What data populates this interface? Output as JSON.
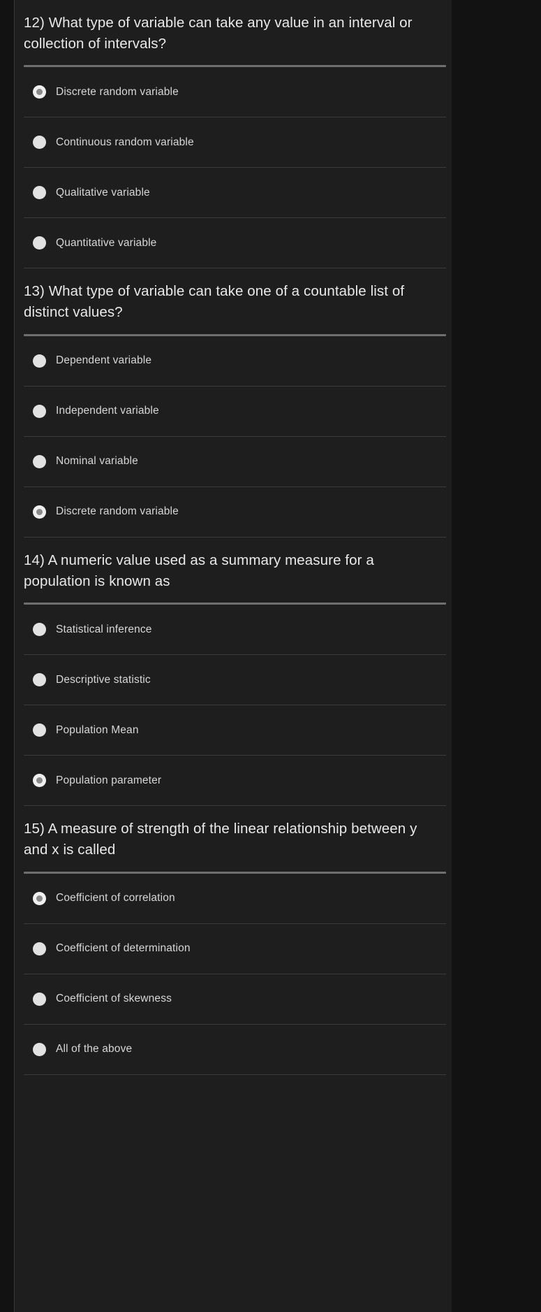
{
  "theme": {
    "page_background": "#121212",
    "panel_background": "#1e1e1e",
    "question_text_color": "#e9e9e9",
    "option_text_color": "#d7d7d7",
    "strong_divider_color": "#6f6f6f",
    "thin_divider_color": "#3b3b3b",
    "radio_fill_color": "#e2e2e2",
    "radio_selected_dot_color": "#8a8a8a"
  },
  "quiz": {
    "questions": [
      {
        "number": "12)",
        "text": "12) What type of variable can take any value in an interval or collection of intervals?",
        "options": [
          {
            "label": "Discrete random variable",
            "selected": true
          },
          {
            "label": "Continuous random variable",
            "selected": false
          },
          {
            "label": "Qualitative variable",
            "selected": false
          },
          {
            "label": "Quantitative variable",
            "selected": false
          }
        ]
      },
      {
        "number": "13)",
        "text": "13) What type of variable can take one of a countable list of distinct values?",
        "options": [
          {
            "label": "Dependent variable",
            "selected": false
          },
          {
            "label": "Independent variable",
            "selected": false
          },
          {
            "label": "Nominal variable",
            "selected": false
          },
          {
            "label": "Discrete random variable",
            "selected": true
          }
        ]
      },
      {
        "number": "14)",
        "text": "14) A numeric value used as a summary measure for a population is known as",
        "options": [
          {
            "label": "Statistical inference",
            "selected": false
          },
          {
            "label": "Descriptive statistic",
            "selected": false
          },
          {
            "label": "Population Mean",
            "selected": false
          },
          {
            "label": "Population parameter",
            "selected": true
          }
        ]
      },
      {
        "number": "15)",
        "text": "15) A measure of strength of the linear relationship between y and x is called",
        "options": [
          {
            "label": "Coefficient of correlation",
            "selected": true
          },
          {
            "label": "Coefficient of determination",
            "selected": false
          },
          {
            "label": "Coefficient of skewness",
            "selected": false
          },
          {
            "label": "All of the above",
            "selected": false
          }
        ]
      }
    ]
  }
}
